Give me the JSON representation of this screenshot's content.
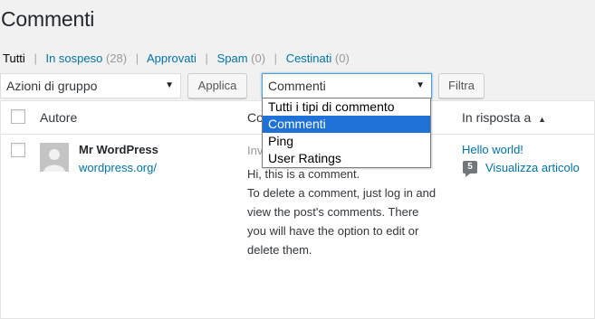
{
  "page": {
    "title": "Commenti"
  },
  "filters": {
    "items": [
      {
        "label": "Tutti",
        "count": ""
      },
      {
        "label": "In sospeso",
        "count": "(28)"
      },
      {
        "label": "Approvati",
        "count": ""
      },
      {
        "label": "Spam",
        "count": "(0)"
      },
      {
        "label": "Cestinati",
        "count": "(0)"
      }
    ]
  },
  "toolbar": {
    "bulk_action_value": "Azioni di gruppo",
    "apply_label": "Applica",
    "type_filter_value": "Commenti",
    "filter_label": "Filtra"
  },
  "type_dropdown": {
    "options": [
      "Tutti i tipi di commento",
      "Commenti",
      "Ping",
      "User Ratings"
    ],
    "selected": "Commenti"
  },
  "table": {
    "headers": {
      "author": "Autore",
      "comment": "Commento",
      "response": "In risposta a",
      "sort_arrow": "▲"
    },
    "rows": [
      {
        "author_name": "Mr WordPress",
        "author_url": "wordpress.org/",
        "comment_meta": "Inviato",
        "comment_lines": [
          "Hi, this is a comment.",
          "To delete a comment, just log in and",
          "view the post's comments. There",
          "you will have the option to edit or",
          "delete them."
        ],
        "post_title": "Hello world!",
        "comment_count": "5",
        "view_post_label": "Visualizza articolo"
      }
    ]
  },
  "colors": {
    "link": "#0073aa",
    "selected_option": "#1e71d6"
  }
}
